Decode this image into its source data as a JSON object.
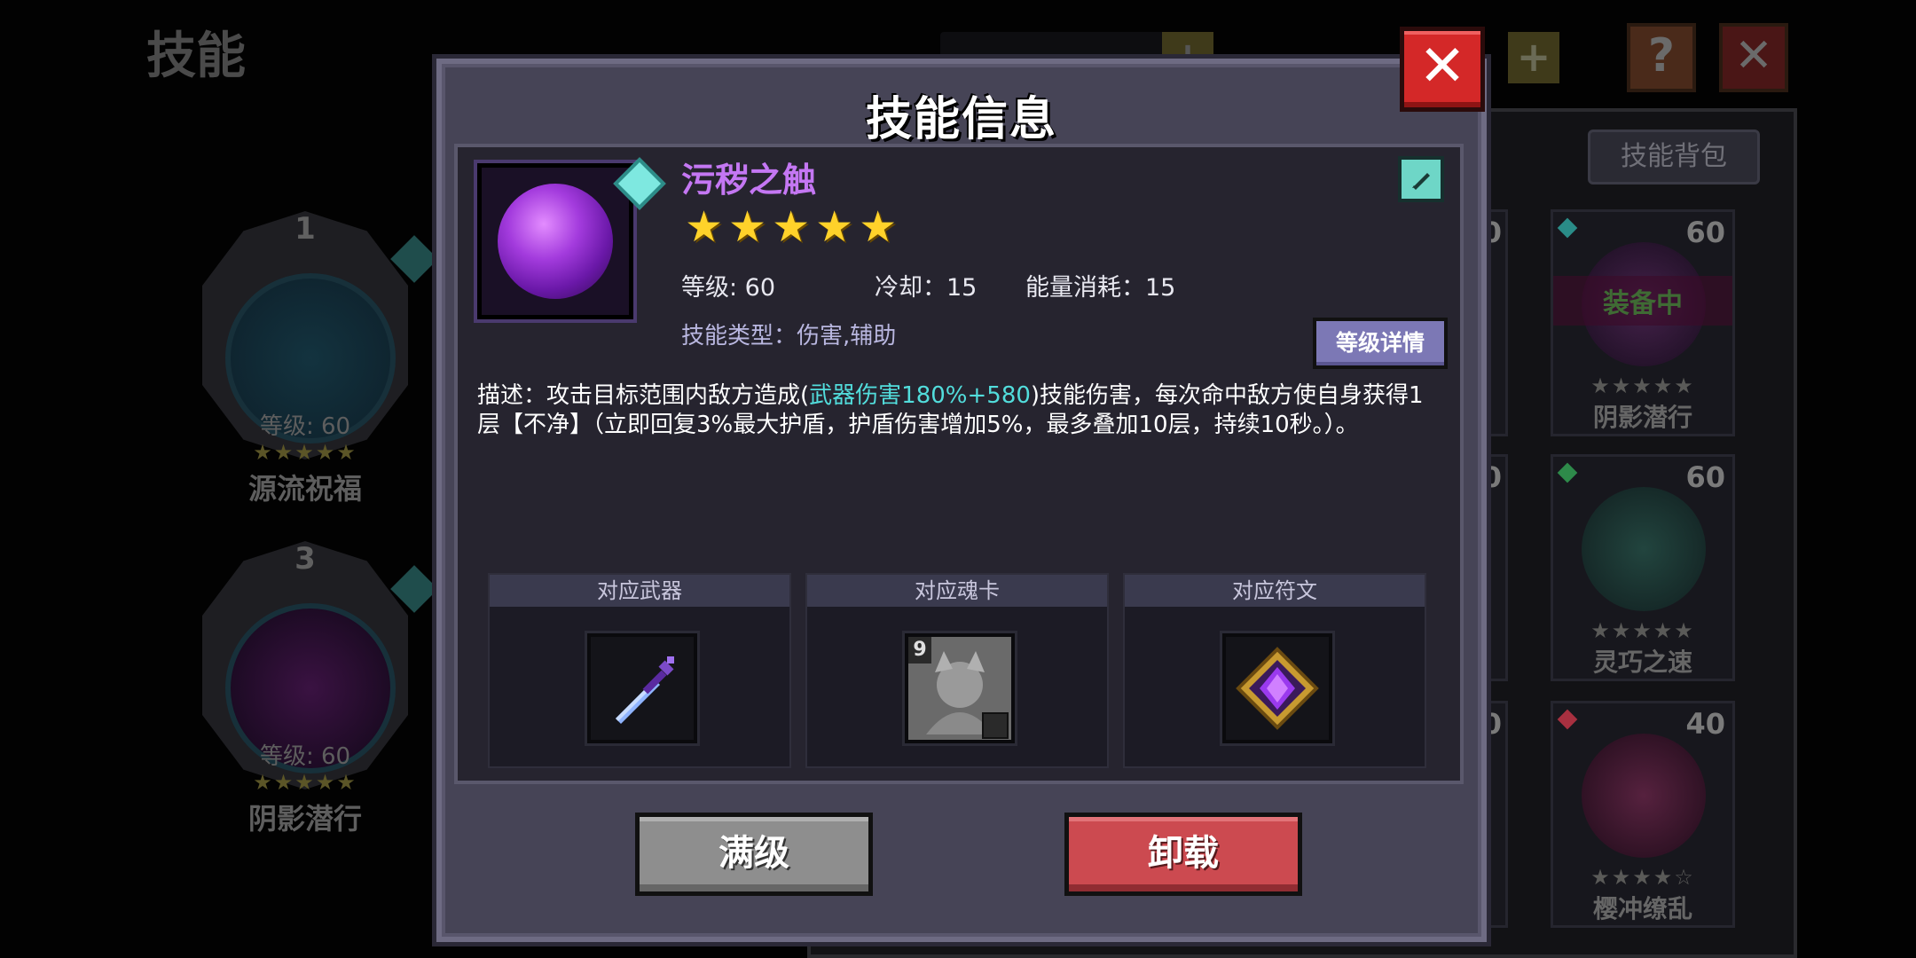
{
  "background": {
    "page_title": "技能",
    "slots": [
      {
        "number": "1",
        "level": "等级: 60",
        "stars": "★★★★★",
        "name": "源流祝福"
      },
      {
        "number": "3",
        "level": "等级: 60",
        "stars": "★★★★★",
        "name": "阴影潜行"
      }
    ],
    "top_bar": {
      "help_icon": "?",
      "close_icon": "✕",
      "add_icon": "+"
    },
    "bag_tab": "技能背包",
    "cards": [
      {
        "level": "60",
        "badge": "装备中",
        "stars": "★★★★★",
        "name": "阴影潜行",
        "gem_color": "#2a8c88"
      },
      {
        "level": "60",
        "stars": "★★★★★",
        "name": "灵巧之速",
        "gem_color": "#2e8a4a"
      },
      {
        "level": "40",
        "stars": "★★★★☆",
        "name": "樱冲缭乱",
        "gem_color": "#a83040"
      }
    ],
    "partial_card_levels": [
      "0",
      "0",
      "0"
    ]
  },
  "modal": {
    "title": "技能信息",
    "close_icon": "✕",
    "skill": {
      "name": "污秽之触",
      "stars": "★★★★★",
      "level": "等级: 60",
      "cooldown": "冷却：15",
      "energy": "能量消耗：15",
      "type": "技能类型：伤害,辅助",
      "edit_icon": "pencil-icon",
      "level_details_label": "等级详情"
    },
    "description": {
      "prefix": "描述：攻击目标范围内敌方造成(",
      "highlight": "武器伤害180%+580",
      "suffix": ")技能伤害，每次命中敌方使自身获得1层【不净】（立即回复3%最大护盾，护盾伤害增加5%，最多叠加10层，持续10秒。）。"
    },
    "related": [
      {
        "label": "对应武器",
        "icon": "sword-icon"
      },
      {
        "label": "对应魂卡",
        "icon": "soul-card-icon",
        "badge": "9"
      },
      {
        "label": "对应符文",
        "icon": "rune-icon"
      }
    ],
    "buttons": {
      "max_level": "满级",
      "unequip": "卸载"
    }
  },
  "colors": {
    "skill_name": "#c477f3",
    "highlight": "#52dddc",
    "close": "#d42828",
    "unequip": "#cc4a50",
    "max_level": "#8e8e8e",
    "stars": "#ffd22a"
  }
}
